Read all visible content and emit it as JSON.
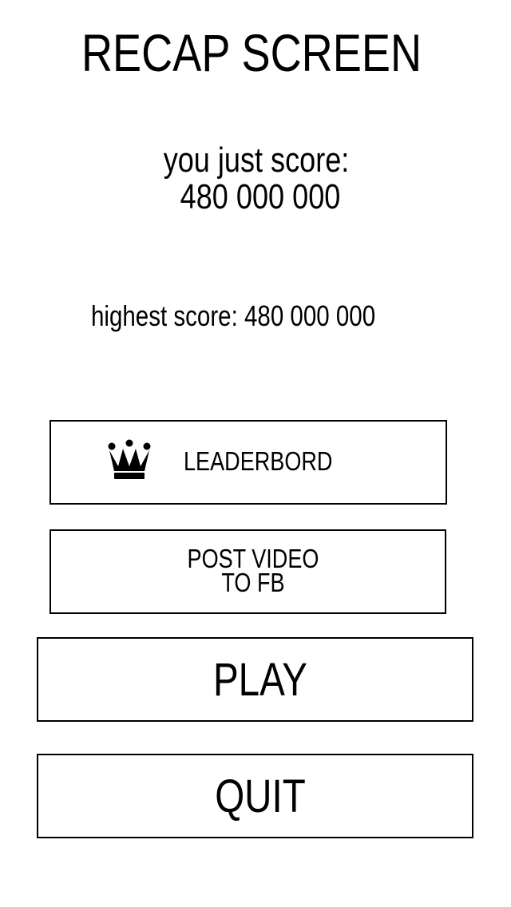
{
  "screen": {
    "title": "RECAP SCREEN"
  },
  "score": {
    "label": "you just score:",
    "value": "480 000 000",
    "highest": "highest score: 480 000 000"
  },
  "buttons": {
    "leaderboard": {
      "label": "LEADERBORD",
      "icon": "crown-icon"
    },
    "post_video": {
      "line1": "POST VIDEO",
      "line2": "TO FB"
    },
    "play": {
      "label": "PLAY"
    },
    "quit": {
      "label": "QUIT"
    }
  },
  "colors": {
    "background": "#ffffff",
    "foreground": "#000000"
  }
}
